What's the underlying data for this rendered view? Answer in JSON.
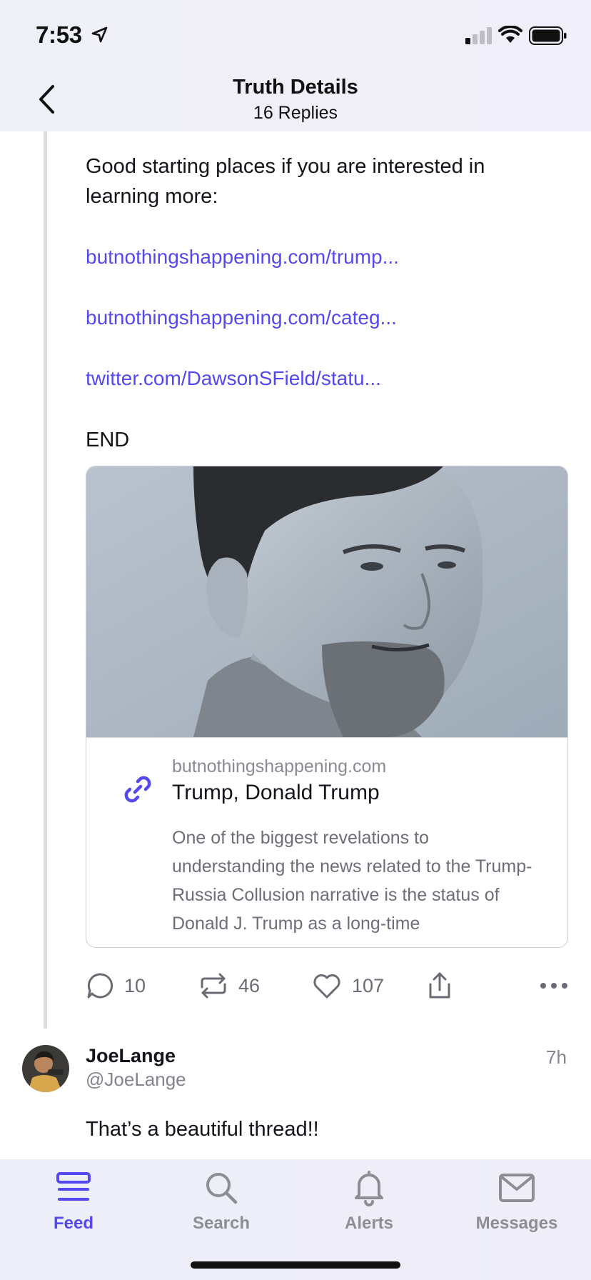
{
  "status_bar": {
    "time": "7:53"
  },
  "header": {
    "title": "Truth Details",
    "subtitle": "16 Replies"
  },
  "post": {
    "intro_text": "Good starting places if you are interested in learning more:",
    "links": [
      "butnothingshappening.com/trump...",
      "butnothingshappening.com/categ...",
      "twitter.com/DawsonSField/statu..."
    ],
    "end_text": "END",
    "card": {
      "domain": "butnothingshappening.com",
      "title": "Trump, Donald Trump",
      "description": "One of the biggest revelations to understanding the news related to the Trump-Russia Collusion narrative is the status of Donald J. Trump as a long-time"
    },
    "actions": {
      "replies": "10",
      "retruths": "46",
      "likes": "107"
    }
  },
  "reply": {
    "display_name": "JoeLange",
    "handle": "@JoeLange",
    "time": "7h",
    "text": "That’s a beautiful thread!!"
  },
  "tab_bar": {
    "tabs": [
      {
        "label": "Feed",
        "icon": "feed-icon",
        "active": true
      },
      {
        "label": "Search",
        "icon": "search-icon",
        "active": false
      },
      {
        "label": "Alerts",
        "icon": "bell-icon",
        "active": false
      },
      {
        "label": "Messages",
        "icon": "envelope-icon",
        "active": false
      }
    ]
  },
  "colors": {
    "accent": "#5448ee",
    "muted_text": "#84848e",
    "thread_line": "#dcdce3"
  }
}
